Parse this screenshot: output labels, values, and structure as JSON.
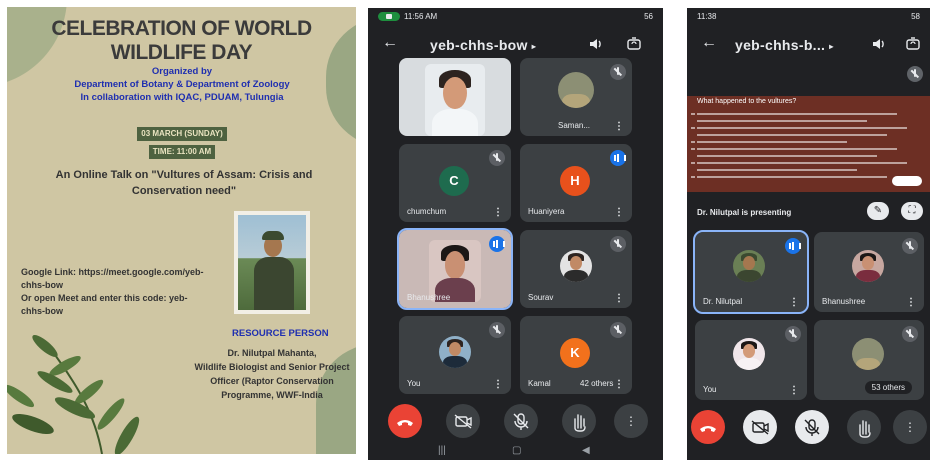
{
  "poster": {
    "title": "CELEBRATION OF  WORLD WILDLIFE DAY",
    "organized_by": "Organized by",
    "departments": "Department of Botany & Department of Zoology",
    "collab": "In collaboration with IQAC, PDUAM, Tulungia",
    "date": "03 MARCH (SUNDAY)",
    "time": "TIME: 11:00 AM",
    "talk_line1": "An Online Talk on \"Vultures of Assam: Crisis and",
    "talk_line2": "Conservation need\"",
    "google_link1": "Google Link: https://meet.google.com/yeb-",
    "google_link2": "chhs-bow",
    "google_or1": "Or open Meet and enter this code: yeb-",
    "google_or2": "chhs-bow",
    "resource_head": "RESOURCE PERSON",
    "rp_line1": "Dr. Nilutpal Mahanta,",
    "rp_line2": "Wildlife Biologist and Senior Project",
    "rp_line3": "Officer (Raptor Conservation",
    "rp_line4": "Programme, WWF-India"
  },
  "phone1": {
    "status_time": "11:56 AM",
    "status_right": "56",
    "meeting_code": "yeb-chhs-bow",
    "caret": "▸",
    "tiles": [
      {
        "name": "Saman..."
      },
      {
        "name": "chumchum",
        "initial": "C",
        "color": "#1e6b4e"
      },
      {
        "name": "Huaniyera",
        "initial": "H",
        "color": "#e8511c"
      },
      {
        "name": "Bhanushree"
      },
      {
        "name": "Sourav"
      },
      {
        "name": "You"
      },
      {
        "name": "Kamal",
        "extra": "42 others",
        "initial": "K",
        "color": "#f2711c"
      }
    ]
  },
  "phone2": {
    "status_time": "11:38",
    "status_right": "58",
    "meeting_code": "yeb-chhs-b...",
    "caret": "▸",
    "slide_title": "What happened to the vultures?",
    "presenting": "Dr. Nilutpal is presenting",
    "tiles": [
      {
        "name": "Dr. Nilutpal"
      },
      {
        "name": "Bhanushree"
      },
      {
        "name": "You"
      },
      {
        "name": "53 others"
      }
    ]
  },
  "icons": {
    "back": "arrow-back-icon",
    "speaker": "speaker-icon",
    "switch_camera": "switch-camera-icon",
    "end_call": "end-call-icon",
    "camera_off": "camera-off-icon",
    "mic_off": "mic-off-icon",
    "raise_hand": "raise-hand-icon",
    "more": "more-options-icon"
  },
  "colors": {
    "meet_bg": "#202124",
    "tile_bg": "#3c4043",
    "end_call": "#ea4335",
    "speaking": "#1a73e8",
    "poster_bg": "#cfc6a3",
    "poster_blue": "#1f2fb0"
  }
}
